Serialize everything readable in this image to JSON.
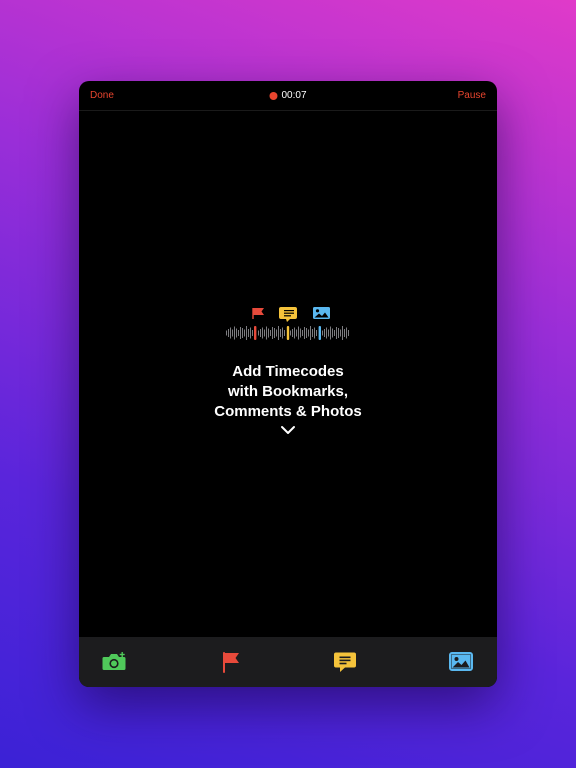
{
  "top_bar": {
    "done_label": "Done",
    "timer": "00:07",
    "pause_label": "Pause"
  },
  "headline_lines": [
    "Add Timecodes",
    "with Bookmarks,",
    "Comments & Photos"
  ],
  "icons": {
    "bookmark": "flag-icon",
    "comment": "comment-icon",
    "photo": "photo-icon",
    "camera": "camera-icon",
    "expand": "chevron-down-icon"
  },
  "colors": {
    "background_top": "#e03ac9",
    "background_bottom": "#3b22d6",
    "accent_red": "#e8452e",
    "bookmark_red": "#e84a3b",
    "comment_yellow": "#f5c33b",
    "photo_blue": "#5ab8f0",
    "camera_green": "#4fc95a",
    "toolbar_bg": "#1c1c1e"
  }
}
